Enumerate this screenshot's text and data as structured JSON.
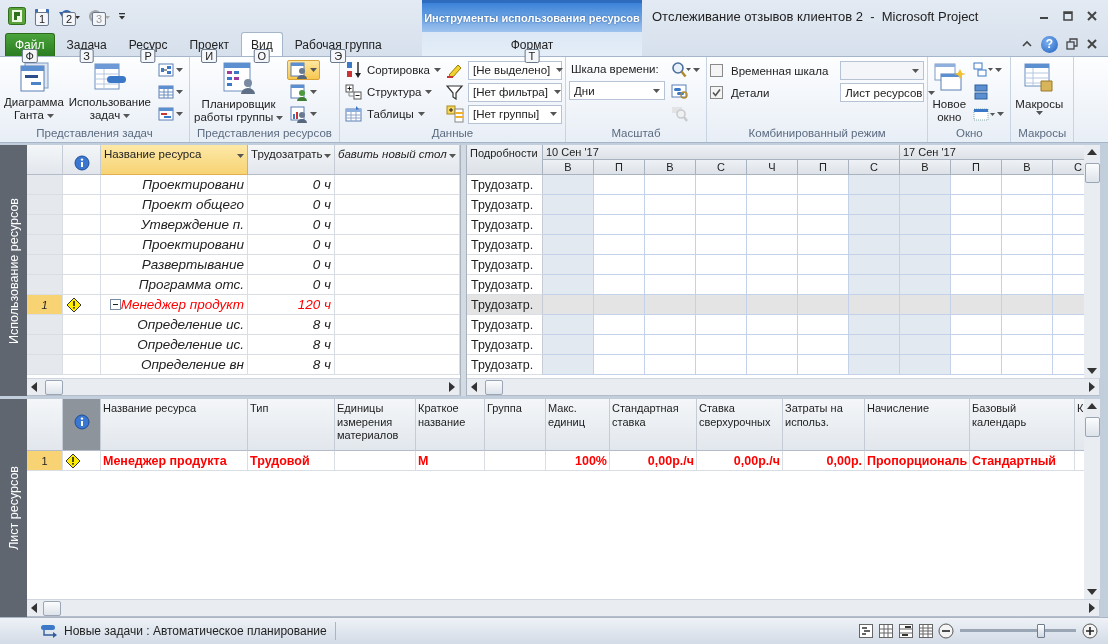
{
  "quick_access": {
    "keytips": [
      "1",
      "2",
      "3"
    ]
  },
  "contextual_group": "Инструменты использования ресурсов",
  "window_title": "Отслеживание отзывов клиентов 2  -  Microsoft Project",
  "help_label": "?",
  "tabs": [
    {
      "label": "Файл",
      "keytip": "Ф",
      "kind": "file",
      "selected": false
    },
    {
      "label": "Задача",
      "keytip": "З",
      "kind": "normal",
      "selected": false
    },
    {
      "label": "Ресурс",
      "keytip": "Р",
      "kind": "normal",
      "selected": false
    },
    {
      "label": "Проект",
      "keytip": "И",
      "kind": "normal",
      "selected": false
    },
    {
      "label": "Вид",
      "keytip": "О",
      "kind": "normal",
      "selected": true
    },
    {
      "label": "Рабочая группа",
      "keytip": "Э",
      "kind": "normal",
      "selected": false
    },
    {
      "label": "Формат",
      "keytip": "Т",
      "kind": "contextual",
      "selected": false
    }
  ],
  "ribbon_groups": [
    {
      "label": "Представления задач",
      "columns": [
        {
          "kind": "large",
          "lines": [
            "Диаграмма",
            "Ганта"
          ],
          "menu": true
        },
        {
          "kind": "large",
          "lines": [
            "Использование",
            "задач"
          ],
          "menu": true
        },
        {
          "kind": "icons",
          "buttons": [
            {
              "menu": true,
              "selected": false,
              "disabled": false
            },
            {
              "menu": true,
              "selected": false,
              "disabled": false
            },
            {
              "menu": true,
              "selected": false,
              "disabled": false
            }
          ]
        }
      ]
    },
    {
      "label": "Представления ресурсов",
      "columns": [
        {
          "kind": "large",
          "lines": [
            "Планировщик",
            "работы группы"
          ],
          "menu": true
        },
        {
          "kind": "icons",
          "buttons": [
            {
              "menu": true,
              "selected": true,
              "disabled": false
            },
            {
              "menu": true,
              "selected": false,
              "disabled": false
            },
            {
              "menu": true,
              "selected": false,
              "disabled": false
            }
          ]
        }
      ]
    },
    {
      "label": "Данные",
      "columns": [
        {
          "kind": "small",
          "buttons": [
            {
              "label": "Сортировка",
              "menu": true
            },
            {
              "label": "Структура",
              "menu": true
            },
            {
              "label": "Таблицы",
              "menu": true
            }
          ]
        },
        {
          "kind": "filters",
          "fields": [
            {
              "value": "[Не выделено]"
            },
            {
              "value": "[Нет фильтра]"
            },
            {
              "value": "[Нет группы]"
            }
          ]
        }
      ]
    },
    {
      "label": "Масштаб",
      "columns": [
        {
          "kind": "timescale",
          "label": "Шкала времени:",
          "value": "Дни"
        },
        {
          "kind": "icons",
          "buttons": [
            {
              "menu": true,
              "selected": false,
              "disabled": false
            },
            {
              "menu": false,
              "selected": false,
              "disabled": false
            },
            {
              "menu": false,
              "selected": false,
              "disabled": true
            }
          ]
        }
      ]
    },
    {
      "label": "Комбинированный режим",
      "columns": [
        {
          "kind": "combined",
          "rows": [
            {
              "label": "Временная шкала",
              "checked": false,
              "disabled": true
            },
            {
              "label": "Детали",
              "checked": true,
              "value": "Лист ресурсов",
              "disabled": false
            }
          ]
        }
      ]
    },
    {
      "label": "Окно",
      "columns": [
        {
          "kind": "large",
          "lines": [
            "Новое",
            "окно"
          ],
          "menu": false
        },
        {
          "kind": "icons",
          "buttons": [
            {
              "menu": true,
              "selected": false,
              "disabled": false
            },
            {
              "menu": false,
              "selected": false,
              "disabled": false
            },
            {
              "menu": true,
              "selected": false,
              "disabled": false
            }
          ]
        }
      ]
    },
    {
      "label": "Макросы",
      "columns": [
        {
          "kind": "large",
          "lines": [
            "Макросы"
          ],
          "menu": true
        }
      ]
    }
  ],
  "usage_view": {
    "side_label": "Использование ресурсов",
    "columns": [
      {
        "kind": "id",
        "selected": false
      },
      {
        "kind": "indicator",
        "selected": false
      },
      {
        "kind": "text",
        "label": "Название ресурса",
        "selected": true
      },
      {
        "kind": "text",
        "label": "Трудозатрать",
        "selected": false
      },
      {
        "kind": "add",
        "label": "бавить новый стол",
        "selected": false
      }
    ],
    "rows": [
      {
        "kind": "assignment",
        "name": "Проектировани",
        "work": "0 ч",
        "detail": "Трудозатр.",
        "selected": false,
        "overallocated": false
      },
      {
        "kind": "assignment",
        "name": "Проект общего",
        "work": "0 ч",
        "detail": "Трудозатр.",
        "selected": false,
        "overallocated": false
      },
      {
        "kind": "assignment",
        "name": "Утверждение п.",
        "work": "0 ч",
        "detail": "Трудозатр.",
        "selected": false,
        "overallocated": false
      },
      {
        "kind": "assignment",
        "name": "Проектировани",
        "work": "0 ч",
        "detail": "Трудозатр.",
        "selected": false,
        "overallocated": false
      },
      {
        "kind": "assignment",
        "name": "Развертывание",
        "work": "0 ч",
        "detail": "Трудозатр.",
        "selected": false,
        "overallocated": false
      },
      {
        "kind": "assignment",
        "name": "Программа отс.",
        "work": "0 ч",
        "detail": "Трудозатр.",
        "selected": false,
        "overallocated": false
      },
      {
        "kind": "resource",
        "id": "1",
        "warning": true,
        "expanded": true,
        "name": "Менеджер продукт",
        "work": "120 ч",
        "detail": "Трудозатр.",
        "selected": true,
        "overallocated": true
      },
      {
        "kind": "assignment",
        "name": "Определение ис.",
        "work": "8 ч",
        "detail": "Трудозатр.",
        "selected": false,
        "overallocated": false
      },
      {
        "kind": "assignment",
        "name": "Определение ис.",
        "work": "8 ч",
        "detail": "Трудозатр.",
        "selected": false,
        "overallocated": false
      },
      {
        "kind": "assignment",
        "name": "Определение вн",
        "work": "8 ч",
        "detail": "Трудозатр.",
        "selected": false,
        "overallocated": false
      }
    ],
    "details_header": "Подробности",
    "weeks": [
      {
        "label": "10 Сен '17"
      },
      {
        "label": "17 Сен '17"
      }
    ],
    "days": [
      {
        "label": "В",
        "nonworking": true
      },
      {
        "label": "П",
        "nonworking": false
      },
      {
        "label": "В",
        "nonworking": false
      },
      {
        "label": "С",
        "nonworking": false
      },
      {
        "label": "Ч",
        "nonworking": false
      },
      {
        "label": "П",
        "nonworking": false
      },
      {
        "label": "С",
        "nonworking": true
      },
      {
        "label": "В",
        "nonworking": true
      },
      {
        "label": "П",
        "nonworking": false
      },
      {
        "label": "В",
        "nonworking": false
      },
      {
        "label": "С",
        "nonworking": false
      }
    ]
  },
  "sheet_view": {
    "side_label": "Лист ресурсов",
    "columns": [
      {
        "kind": "id"
      },
      {
        "kind": "indicator"
      },
      {
        "kind": "text",
        "label": "Название ресурса"
      },
      {
        "kind": "text",
        "label": "Тип"
      },
      {
        "kind": "text",
        "label": "Единицы измерения материалов"
      },
      {
        "kind": "text",
        "label": "Краткое название"
      },
      {
        "kind": "text",
        "label": "Группа"
      },
      {
        "kind": "text",
        "label": "Макс. единиц"
      },
      {
        "kind": "text",
        "label": "Стандартная ставка"
      },
      {
        "kind": "text",
        "label": "Ставка сверхурочных"
      },
      {
        "kind": "text",
        "label": "Затраты на использ."
      },
      {
        "kind": "text",
        "label": "Начисление"
      },
      {
        "kind": "text",
        "label": "Базовый календарь"
      },
      {
        "kind": "text",
        "label": "К"
      }
    ],
    "rows": [
      {
        "warning": true,
        "selected": true,
        "overallocated": true,
        "cells": [
          "1",
          null,
          "Менеджер продукта",
          "Трудовой",
          null,
          "М",
          null,
          "100%",
          "0,00р./ч",
          "0,00р./ч",
          "0,00р.",
          "Пропорциональ",
          "Стандартный",
          null
        ]
      }
    ]
  },
  "status": {
    "mode_text": "Новые задачи : Автоматическое планирование",
    "zoom": {
      "level": 0.7
    }
  }
}
